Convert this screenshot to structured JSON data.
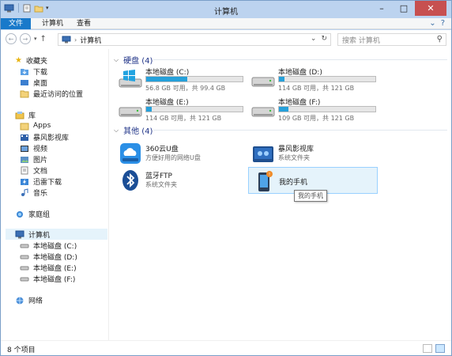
{
  "window": {
    "title": "计算机"
  },
  "ribbon": {
    "tabs": [
      "文件",
      "计算机",
      "查看"
    ]
  },
  "address": {
    "path": "计算机"
  },
  "search": {
    "placeholder": "搜索 计算机"
  },
  "nav": {
    "favorites": {
      "label": "收藏夹",
      "items": [
        "下载",
        "桌面",
        "最近访问的位置"
      ]
    },
    "libraries": {
      "label": "库",
      "items": [
        "Apps",
        "暴风影视库",
        "视频",
        "图片",
        "文档",
        "迅雷下载",
        "音乐"
      ]
    },
    "homegroup": "家庭组",
    "computer": {
      "label": "计算机",
      "items": [
        "本地磁盘 (C:)",
        "本地磁盘 (D:)",
        "本地磁盘 (E:)",
        "本地磁盘 (F:)"
      ]
    },
    "network": "网络"
  },
  "groups": {
    "drives": {
      "header": "硬盘 (4)"
    },
    "others": {
      "header": "其他 (4)"
    }
  },
  "drives": [
    {
      "name": "本地磁盘 (C:)",
      "info": "56.8 GB 可用，共 99.4 GB",
      "used_fraction": 0.43
    },
    {
      "name": "本地磁盘 (D:)",
      "info": "114 GB 可用，共 121 GB",
      "used_fraction": 0.06
    },
    {
      "name": "本地磁盘 (E:)",
      "info": "114 GB 可用，共 121 GB",
      "used_fraction": 0.06
    },
    {
      "name": "本地磁盘 (F:)",
      "info": "109 GB 可用，共 121 GB",
      "used_fraction": 0.1
    }
  ],
  "others": [
    {
      "name": "360云U盘",
      "sub": "方便好用的网络U盘"
    },
    {
      "name": "暴风影视库",
      "sub": "系统文件夹"
    },
    {
      "name": "蓝牙FTP",
      "sub": "系统文件夹"
    },
    {
      "name": "我的手机",
      "sub": ""
    }
  ],
  "tooltip": "我的手机",
  "status": {
    "count": "8 个项目"
  },
  "colors": {
    "accent": "#1979ca",
    "bar_fill": "#26a0da",
    "selection": "#e5f3fb"
  }
}
